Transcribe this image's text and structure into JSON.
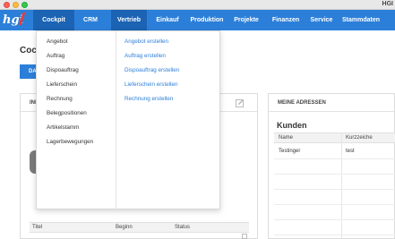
{
  "window": {
    "title": "HGI"
  },
  "navbar": {
    "logo": "hgi",
    "items": [
      "Cockpit",
      "CRM",
      "Vertrieb",
      "Einkauf",
      "Produktion",
      "Projekte",
      "Finanzen",
      "Service",
      "Stammdaten"
    ]
  },
  "page": {
    "title": "Cock",
    "tab_label": "DAS"
  },
  "left_panel": {
    "title": "INF",
    "table_headers": [
      "Titel",
      "Beginn",
      "Status"
    ]
  },
  "right_panel": {
    "title": "MEINE ADRESSEN",
    "section": "Kunden",
    "headers": [
      "Name",
      "Kurzzeiche"
    ],
    "rows": [
      {
        "name": "Testinger",
        "short": "test"
      }
    ]
  },
  "dropdown": {
    "items": [
      "Angebot",
      "Auftrag",
      "Dispoauftrag",
      "Lieferschein",
      "Rechnung",
      "Belegpositionen",
      "Artikelstamm",
      "Lagerbewegungen"
    ],
    "sub_items": [
      "Angebot erstellen",
      "Auftrag erstellen",
      "Dispoauftrag erstellen",
      "Lieferschein erstellen",
      "Rechnung erstellen"
    ]
  },
  "colors": {
    "brand": "#2c7fd9",
    "brand_dark": "#1c63b3",
    "link": "#2c7fd9"
  }
}
